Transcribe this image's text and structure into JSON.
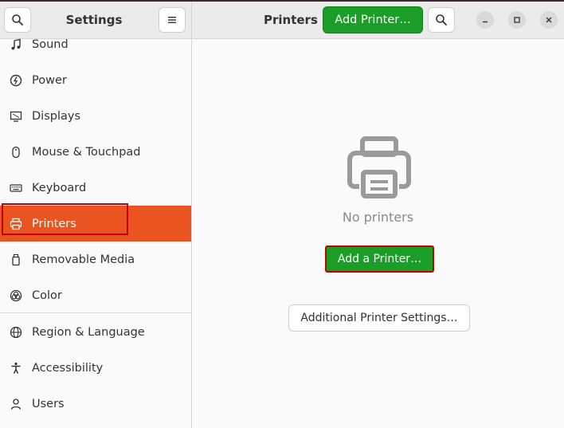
{
  "sidebar": {
    "title": "Settings",
    "items": [
      {
        "label": "Sound",
        "icon": "music-note-icon"
      },
      {
        "label": "Power",
        "icon": "power-icon"
      },
      {
        "label": "Displays",
        "icon": "display-icon"
      },
      {
        "label": "Mouse & Touchpad",
        "icon": "mouse-icon"
      },
      {
        "label": "Keyboard",
        "icon": "keyboard-icon"
      },
      {
        "label": "Printers",
        "icon": "printer-icon",
        "selected": true
      },
      {
        "label": "Removable Media",
        "icon": "usb-drive-icon"
      },
      {
        "label": "Color",
        "icon": "color-icon"
      },
      {
        "label": "Region & Language",
        "icon": "globe-icon"
      },
      {
        "label": "Accessibility",
        "icon": "accessibility-icon"
      },
      {
        "label": "Users",
        "icon": "user-icon"
      }
    ]
  },
  "header": {
    "title": "Printers",
    "add_printer_label": "Add Printer…"
  },
  "main": {
    "empty_text": "No printers",
    "add_button_label": "Add a Printer…",
    "additional_settings_label": "Additional Printer Settings…"
  },
  "colors": {
    "accent": "#e95420",
    "add_button": "#1a9e28",
    "highlight_border": "#c40000"
  }
}
